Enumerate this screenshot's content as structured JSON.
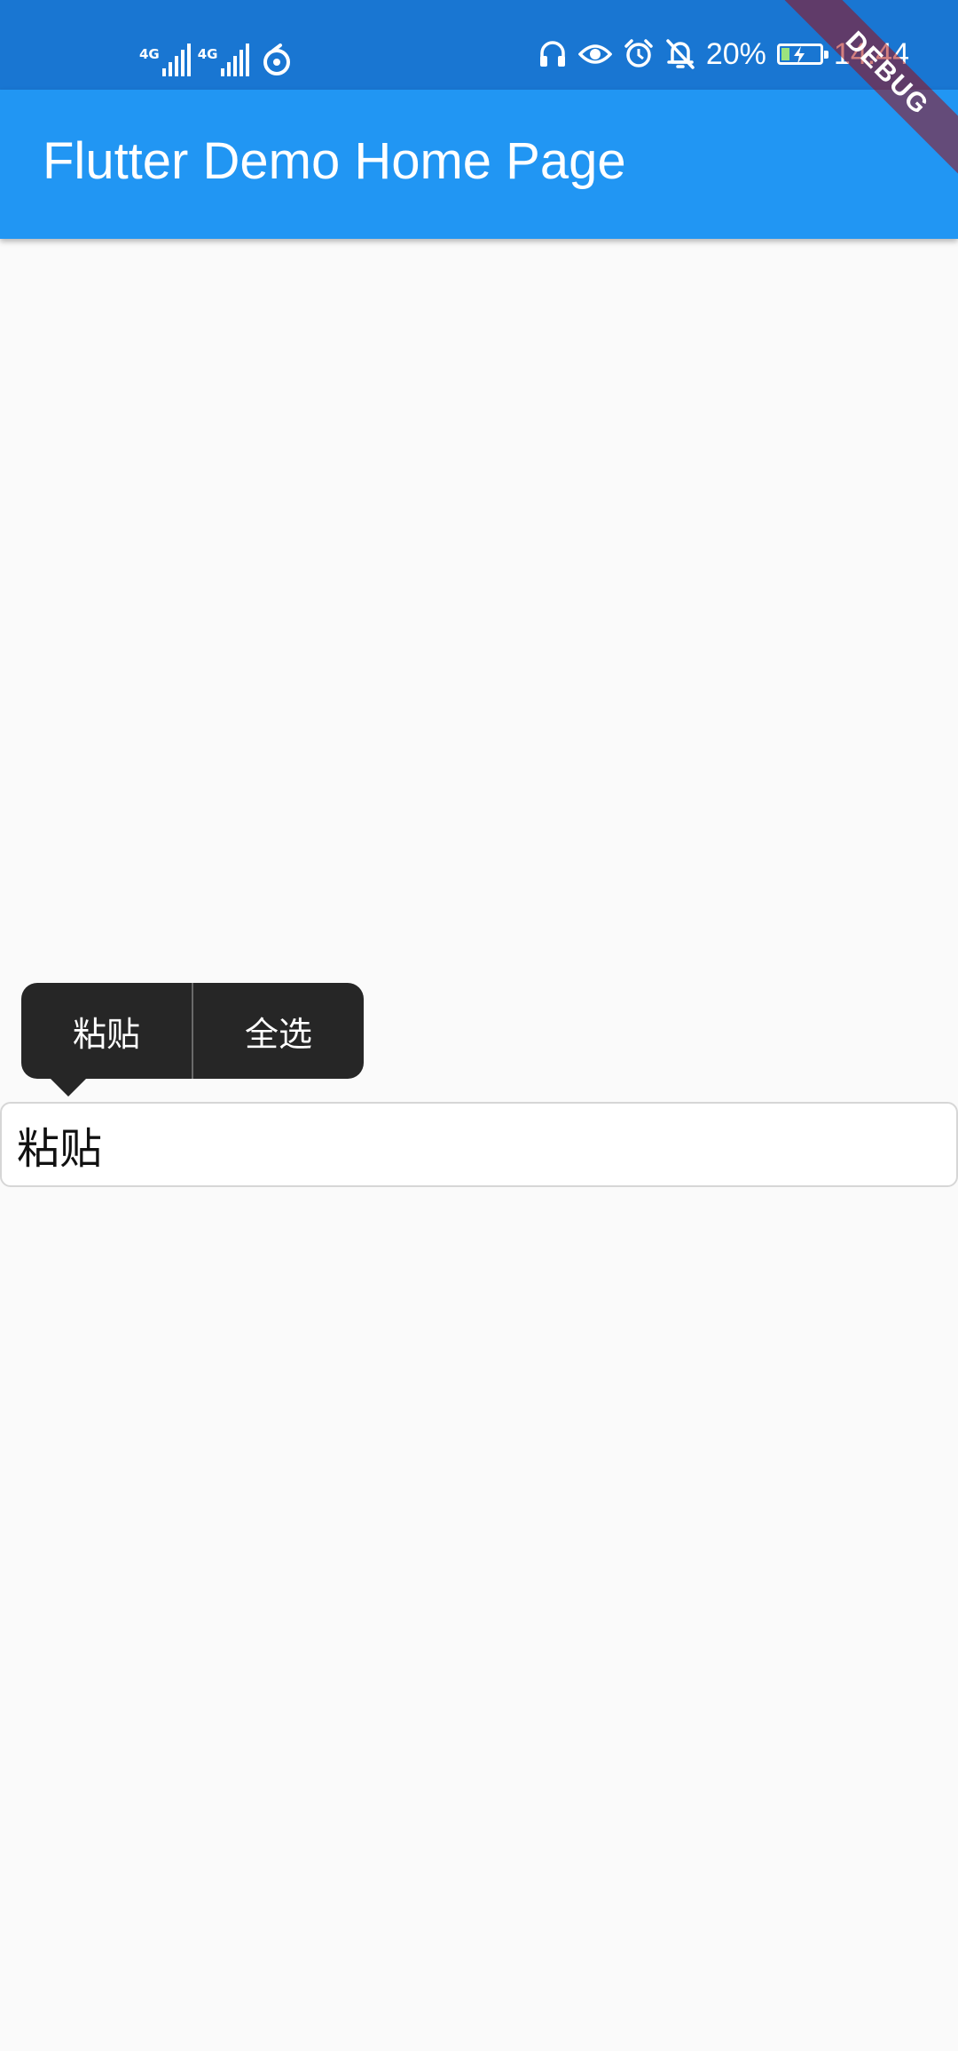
{
  "status_bar": {
    "network_1": "4G",
    "network_2": "4G",
    "battery_percent": "20%",
    "battery_level": 0.2,
    "time": "14:44",
    "icons": [
      "signal-icon",
      "signal-icon",
      "sync-icon",
      "headphones-icon",
      "eye-icon",
      "alarm-icon",
      "mute-icon",
      "battery-icon"
    ]
  },
  "app_bar": {
    "title": "Flutter Demo Home Page",
    "color": "#2196f3"
  },
  "debug_banner": {
    "label": "DEBUG"
  },
  "selection_toolbar": {
    "paste_label": "粘贴",
    "select_all_label": "全选"
  },
  "text_field": {
    "value": "粘贴"
  },
  "colors": {
    "status_bar": "#1976d2",
    "background": "#fafafa",
    "toolbar": "#262626"
  }
}
